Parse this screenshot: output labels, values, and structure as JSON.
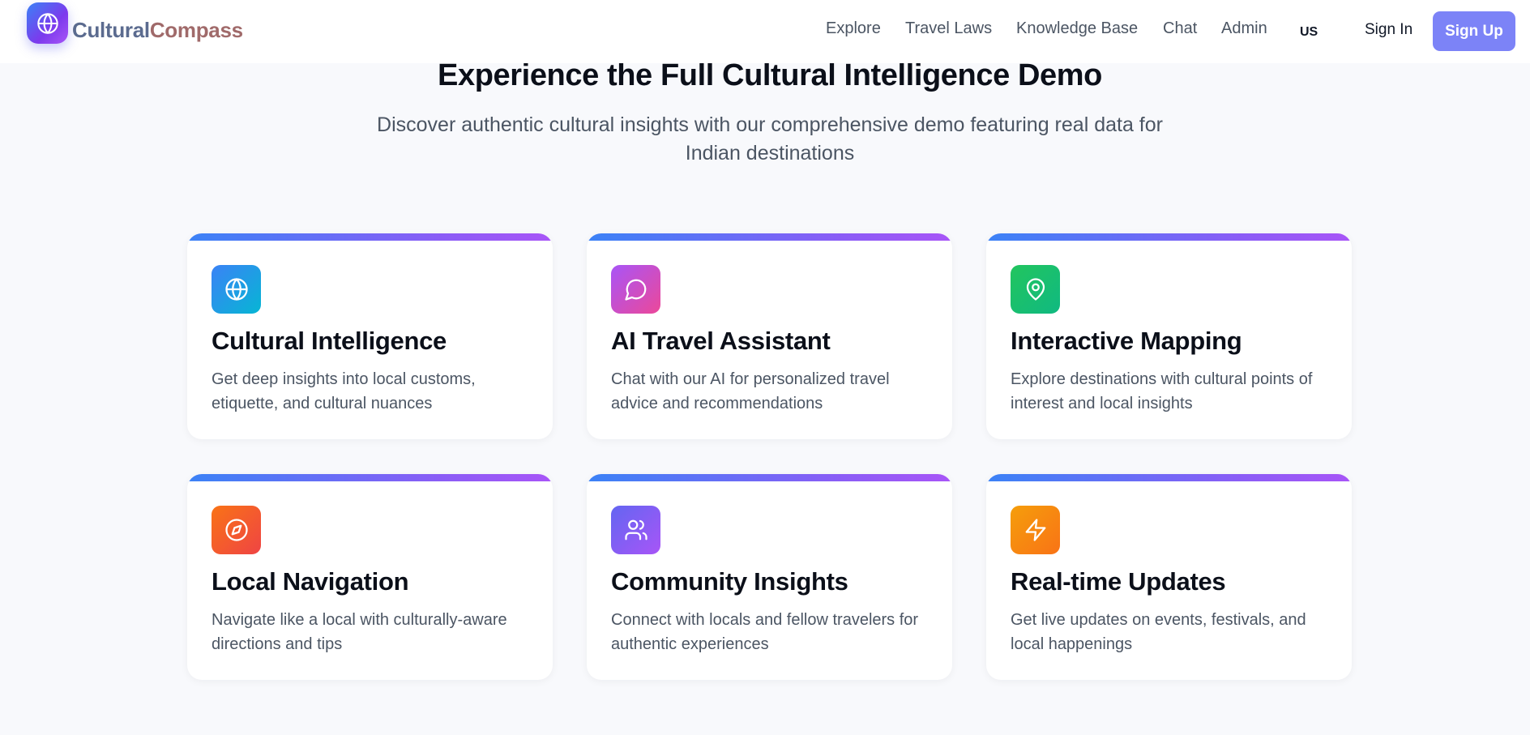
{
  "header": {
    "logo_part1": "Cultural",
    "logo_part2": "Compass",
    "logo_icon": "globe-icon",
    "nav": [
      "Explore",
      "Travel Laws",
      "Knowledge Base",
      "Chat",
      "Admin"
    ],
    "language": "US",
    "sign_in": "Sign In",
    "sign_up": "Sign Up"
  },
  "hero": {
    "title": "Experience the Full Cultural Intelligence Demo",
    "subtitle": "Discover authentic cultural insights with our comprehensive demo featuring real data for Indian destinations"
  },
  "features": [
    {
      "title": "Cultural Intelligence",
      "description": "Get deep insights into local customs, etiquette, and cultural nuances",
      "icon": "globe-icon",
      "color": "#3b82f6"
    },
    {
      "title": "AI Travel Assistant",
      "description": "Chat with our AI for personalized travel advice and recommendations",
      "icon": "chat-bubble-icon",
      "color": "#d946ef"
    },
    {
      "title": "Interactive Mapping",
      "description": "Explore destinations with cultural points of interest and local insights",
      "icon": "map-pin-icon",
      "color": "#22c55e"
    },
    {
      "title": "Local Navigation",
      "description": "Navigate like a local with culturally-aware directions and tips",
      "icon": "compass-icon",
      "color": "#f97316"
    },
    {
      "title": "Community Insights",
      "description": "Connect with locals and fellow travelers for authentic experiences",
      "icon": "users-icon",
      "color": "#8b5cf6"
    },
    {
      "title": "Real-time Updates",
      "description": "Get live updates on events, festivals, and local happenings",
      "icon": "lightning-icon",
      "color": "#f59e0b"
    }
  ],
  "colors": {
    "accent": "#7c83f7",
    "card_top_bar_start": "#3b82f6",
    "card_top_bar_end": "#a855f7",
    "background": "#f8f9fc"
  }
}
